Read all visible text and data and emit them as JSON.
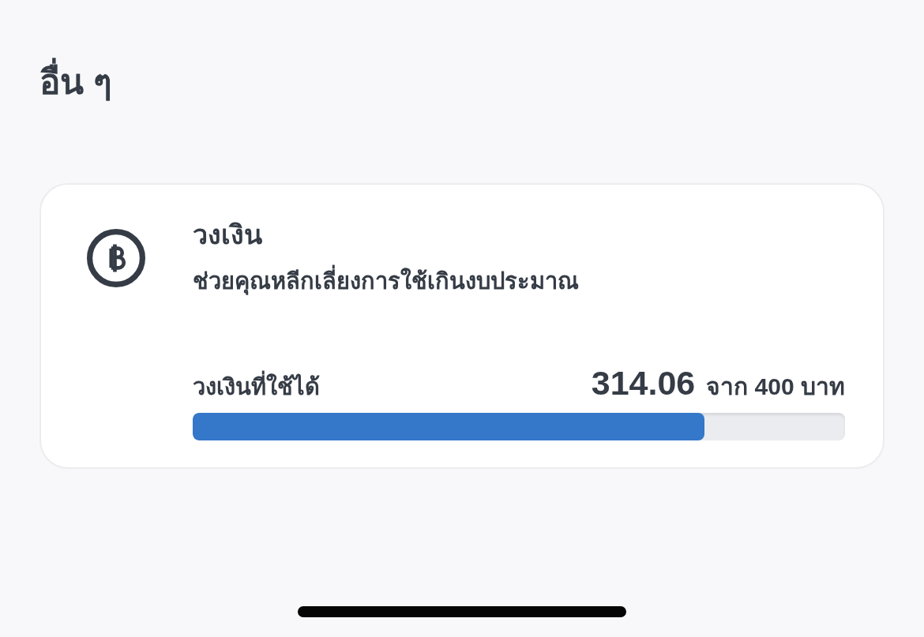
{
  "section": {
    "title": "อื่น ๆ"
  },
  "budget_card": {
    "title": "วงเงิน",
    "description": "ช่วยคุณหลีกเลี่ยงการใช้เกินงบประมาณ",
    "available_label": "วงเงินที่ใช้ได้",
    "amount": "314.06",
    "total": "จาก 400 บาท",
    "level": 0.785
  }
}
